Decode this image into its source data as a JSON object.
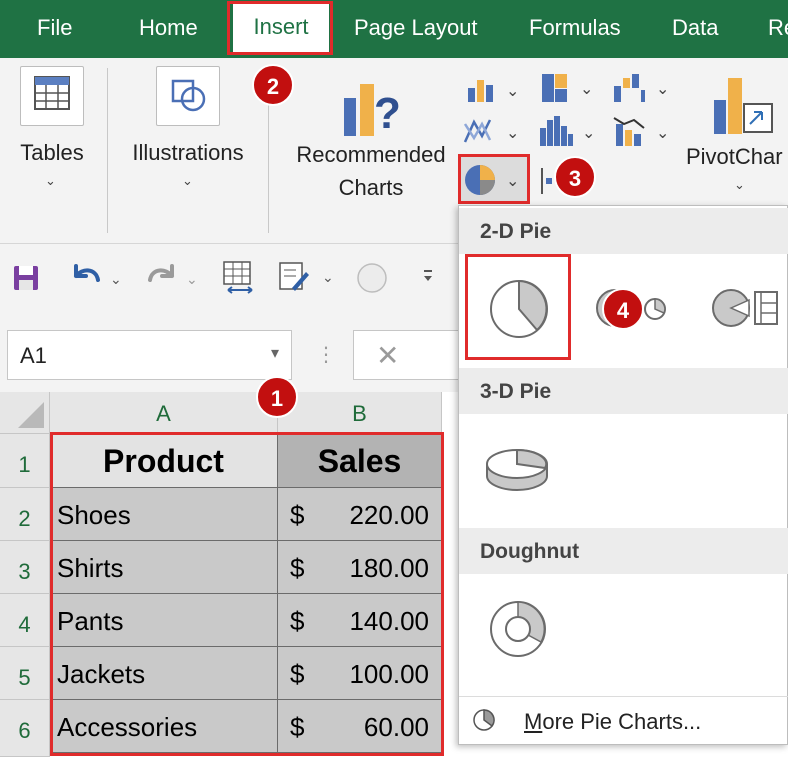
{
  "tabs": [
    {
      "label": "File"
    },
    {
      "label": "Home"
    },
    {
      "label": "Insert"
    },
    {
      "label": "Page Layout"
    },
    {
      "label": "Formulas"
    },
    {
      "label": "Data"
    },
    {
      "label": "Re"
    }
  ],
  "ribbon": {
    "tables_label": "Tables",
    "illustrations_label": "Illustrations",
    "recommended_line1": "Recommended",
    "recommended_line2": "Charts",
    "pivot_label": "PivotChar",
    "chevron": "⌄"
  },
  "callouts": [
    "1",
    "2",
    "3",
    "4"
  ],
  "namebox": {
    "value": "A1",
    "arrow": "▾"
  },
  "formula": {
    "cancel_glyph": "✕",
    "menu_dots": "⋮"
  },
  "grid": {
    "columns": [
      "A",
      "B"
    ],
    "row_numbers": [
      "1",
      "2",
      "3",
      "4",
      "5",
      "6"
    ],
    "headers": {
      "product": "Product",
      "sales": "Sales"
    },
    "rows": [
      {
        "product": "Shoes",
        "currency": "$",
        "amount": "220.00"
      },
      {
        "product": "Shirts",
        "currency": "$",
        "amount": "180.00"
      },
      {
        "product": "Pants",
        "currency": "$",
        "amount": "140.00"
      },
      {
        "product": "Jackets",
        "currency": "$",
        "amount": "100.00"
      },
      {
        "product": "Accessories",
        "currency": "$",
        "amount": "60.00"
      }
    ]
  },
  "gallery": {
    "section_2d": "2-D Pie",
    "section_3d": "3-D Pie",
    "section_doughnut": "Doughnut",
    "more_first_letter": "M",
    "more_rest": "ore Pie Charts..."
  },
  "colors": {
    "excel_green": "#1f7244",
    "callout_red": "#c20f0f",
    "highlight_red": "#e02b2b",
    "selection_gray": "#c9c9c9"
  }
}
